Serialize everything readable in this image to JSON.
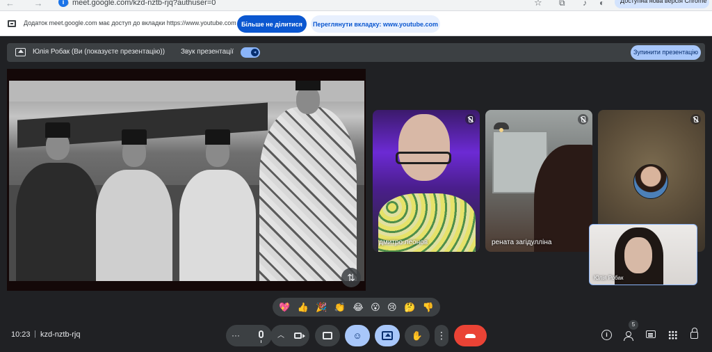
{
  "browser": {
    "nav_arrows": "← →  ↻",
    "site_badge": "i",
    "url": "meet.google.com/kzd-nztb-rjq?authuser=0",
    "update_pill": "Доступна нова версія Chrome"
  },
  "infobar": {
    "message": "Додаток meet.google.com має доступ до вкладки https://www.youtube.com",
    "stop_sharing_label": "Більше не ділитися",
    "view_tab_label": "Переглянути вкладку: www.youtube.com"
  },
  "present_bar": {
    "presenter_label": "Юлія Робак (Ви (показуєте презентацію))",
    "sound_label": "Звук презентації",
    "stop_presenting_label": "Зупинити презентацію"
  },
  "participants": [
    {
      "name": "дмитро леонов",
      "muted": true
    },
    {
      "name": "рената загідулліна",
      "muted": true
    },
    {
      "name": "",
      "muted": true
    }
  ],
  "self_view": {
    "name": "Юлія Робак"
  },
  "reactions": [
    "💖",
    "👍",
    "🎉",
    "👏",
    "😂",
    "😮",
    "😢",
    "🤔",
    "👎"
  ],
  "bottom_bar": {
    "time": "10:23",
    "separator": "|",
    "meeting_code": "kzd-nztb-rjq",
    "people_count": "5"
  },
  "colors": {
    "background": "#202124",
    "accent": "#a8c7fa",
    "leave": "#ea4335",
    "primary_button": "#0b57d0"
  }
}
